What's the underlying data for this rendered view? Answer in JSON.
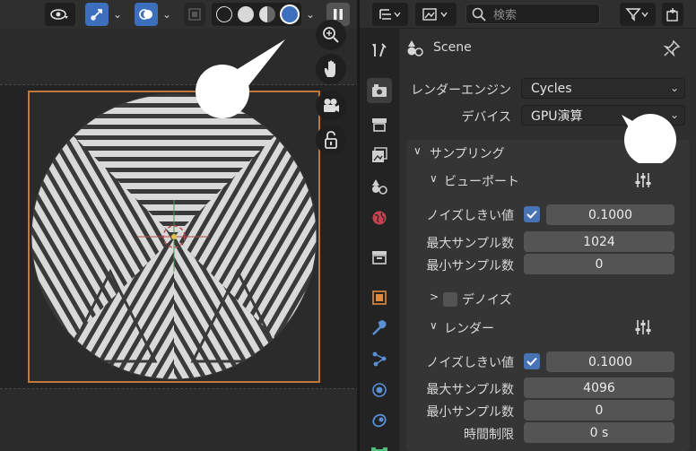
{
  "viewport": {
    "header_icons": [
      "view-transform-icon",
      "gizmo-icon",
      "overlay-icon",
      "xray-icon",
      "wireframe-shading-icon",
      "solid-shading-icon",
      "material-shading-icon",
      "rendered-shading-icon",
      "pause-icon"
    ],
    "nav_icons": [
      "zoom-icon",
      "pan-hand-icon",
      "camera-view-icon",
      "lock-icon"
    ],
    "frame_color": "#c2773a"
  },
  "properties": {
    "search_placeholder": "検索",
    "scene_label": "Scene",
    "render_engine": {
      "label": "レンダーエンジン",
      "value": "Cycles"
    },
    "device": {
      "label": "デバイス",
      "value": "GPU演算"
    },
    "sampling": {
      "title": "サンプリング",
      "viewport": {
        "title": "ビューポート",
        "noise_threshold_label": "ノイズしきい値",
        "noise_threshold": "0.1000",
        "max_samples_label": "最大サンプル数",
        "max_samples": "1024",
        "min_samples_label": "最小サンプル数",
        "min_samples": "0",
        "denoise_label": "デノイズ"
      },
      "render": {
        "title": "レンダー",
        "noise_threshold_label": "ノイズしきい値",
        "noise_threshold": "0.1000",
        "max_samples_label": "最大サンプル数",
        "max_samples": "4096",
        "min_samples_label": "最小サンプル数",
        "min_samples": "0",
        "time_limit_label": "時間制限",
        "time_limit": "0 s"
      }
    },
    "accent_color": "#4772b3"
  }
}
